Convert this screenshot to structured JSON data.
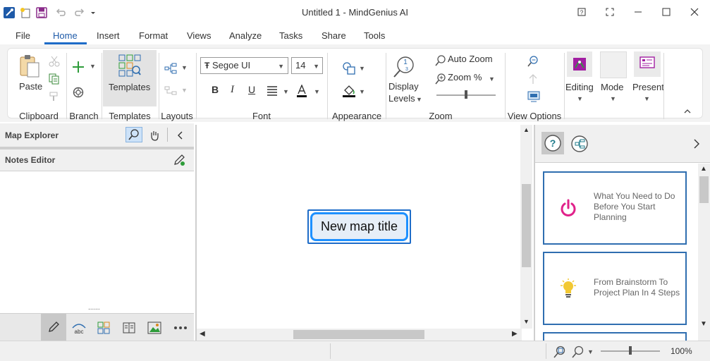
{
  "window": {
    "title": "Untitled 1 - MindGenius AI"
  },
  "titlebar": {
    "quick_access_icons": [
      "app-icon",
      "new-map-icon",
      "save-icon",
      "undo-icon",
      "redo-icon",
      "customize-dropdown-icon"
    ],
    "window_buttons": [
      "help-icon",
      "fullscreen-icon",
      "minimize-icon",
      "maximize-icon",
      "close-icon"
    ]
  },
  "menu": {
    "tabs": [
      "File",
      "Home",
      "Insert",
      "Format",
      "Views",
      "Analyze",
      "Tasks",
      "Share",
      "Tools"
    ],
    "active": "Home"
  },
  "ribbon": {
    "clipboard": {
      "paste_label": "Paste",
      "group_label": "Clipboard"
    },
    "branch": {
      "group_label": "Branch"
    },
    "templates": {
      "button_label": "Templates",
      "group_label": "Templates"
    },
    "layouts": {
      "group_label": "Layouts"
    },
    "font": {
      "family": "Segoe UI",
      "size": "14",
      "format_buttons": [
        "B",
        "I",
        "U"
      ],
      "text_color": "#c00000",
      "group_label": "Font"
    },
    "appearance": {
      "group_label": "Appearance"
    },
    "zoom": {
      "display_levels_label_1": "Display",
      "display_levels_label_2": "Levels",
      "auto_zoom_label": "Auto Zoom",
      "zoom_percent_label": "Zoom %",
      "slider_level": 0.5,
      "group_label": "Zoom"
    },
    "view_options": {
      "group_label": "View Options"
    },
    "modes": {
      "editing_label": "Editing",
      "mode_label": "Mode",
      "present_label": "Present"
    }
  },
  "left_panel": {
    "map_explorer_title": "Map Explorer",
    "notes_editor_title": "Notes Editor",
    "grip": "......",
    "bottom_tools": [
      "pencil-icon",
      "abc-shape-icon",
      "grid-icon",
      "book-icon",
      "image-icon",
      "more-icon"
    ]
  },
  "canvas": {
    "node_title": "New map title",
    "node_color": "#1e90ff"
  },
  "right_panel": {
    "cards": [
      {
        "icon": "power-icon",
        "text_1": "What You Need to Do",
        "text_2": "Before You Start",
        "text_3": "Planning"
      },
      {
        "icon": "lightbulb-icon",
        "text_1": "From Brainstorm To",
        "text_2": "Project Plan In 4 Steps"
      }
    ]
  },
  "statusbar": {
    "zoom_level": "100%",
    "zoom_slider_level": 0.5
  },
  "colors": {
    "accent": "#1e6cc8",
    "card_border": "#2f6eb0",
    "power_icon": "#e0218a",
    "lightbulb": "#f2c832"
  }
}
